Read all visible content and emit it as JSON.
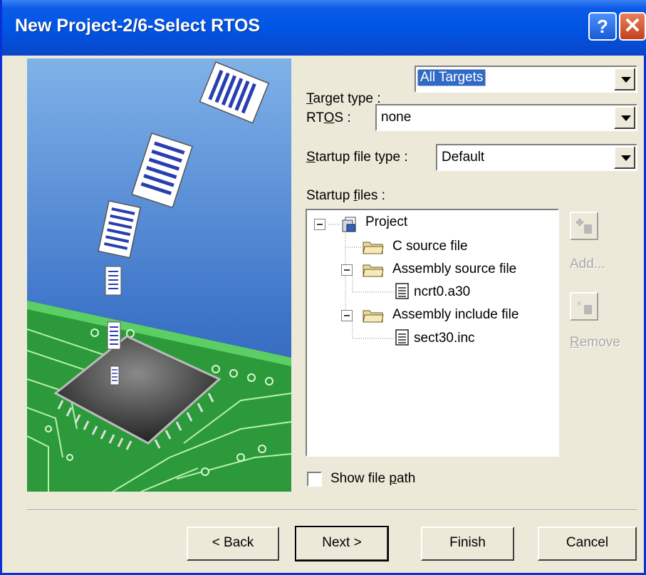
{
  "window": {
    "title": "New Project-2/6-Select RTOS",
    "help_label": "?",
    "close_label": "✕"
  },
  "form": {
    "target_type": {
      "label_accel": "T",
      "label_rest": "arget type :",
      "value": "All Targets"
    },
    "rtos": {
      "label_pre": "RT",
      "label_accel": "O",
      "label_rest": "S :",
      "value": "none"
    },
    "startup_type": {
      "label_accel": "S",
      "label_rest": "tartup file type :",
      "value": "Default"
    },
    "startup_files": {
      "label_pre": "Startup ",
      "label_accel": "f",
      "label_rest": "iles :"
    }
  },
  "tree": {
    "root": "Project",
    "items": [
      "C source file",
      "Assembly source file",
      "ncrt0.a30",
      "Assembly include file",
      "sect30.inc"
    ]
  },
  "side": {
    "add_label": "Add...",
    "remove_accel": "R",
    "remove_rest": "emove"
  },
  "show_path": {
    "label_pre": "Show file ",
    "label_accel": "p",
    "label_rest": "ath",
    "checked": false
  },
  "buttons": {
    "back": "< Back",
    "next": "Next >",
    "finish": "Finish",
    "cancel": "Cancel"
  }
}
